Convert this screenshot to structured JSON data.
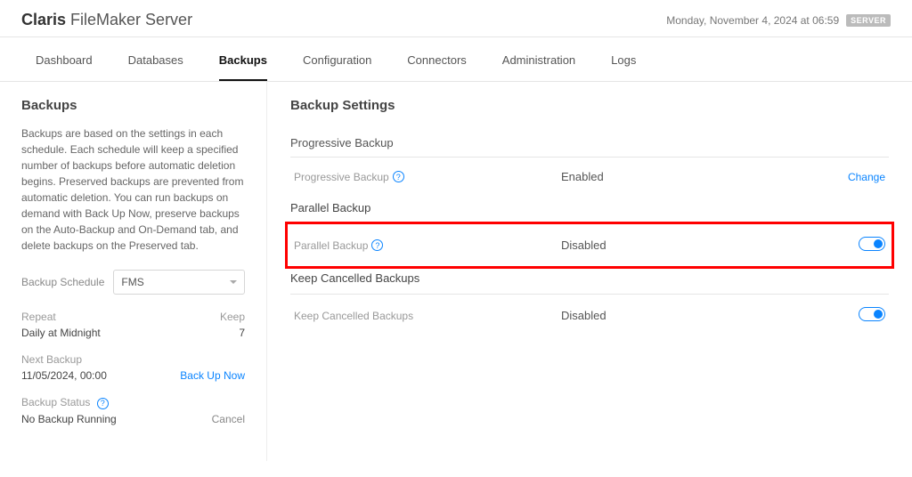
{
  "header": {
    "brand_bold": "Claris",
    "brand_light": " FileMaker Server",
    "datetime": "Monday, November 4, 2024 at 06:59",
    "badge": "SERVER"
  },
  "tabs": [
    {
      "label": "Dashboard",
      "active": false
    },
    {
      "label": "Databases",
      "active": false
    },
    {
      "label": "Backups",
      "active": true
    },
    {
      "label": "Configuration",
      "active": false
    },
    {
      "label": "Connectors",
      "active": false
    },
    {
      "label": "Administration",
      "active": false
    },
    {
      "label": "Logs",
      "active": false
    }
  ],
  "sidebar": {
    "title": "Backups",
    "description": "Backups are based on the settings in each schedule. Each schedule will keep a specified number of backups before automatic deletion begins. Preserved backups are prevented from automatic deletion. You can run backups on demand with Back Up Now, preserve backups on the Auto-Backup and On-Demand tab, and delete backups on the Preserved tab.",
    "schedule_label": "Backup Schedule",
    "schedule_value": "FMS",
    "repeat_label": "Repeat",
    "repeat_value": "Daily at Midnight",
    "keep_label": "Keep",
    "keep_value": "7",
    "next_backup_label": "Next Backup",
    "next_backup_value": "11/05/2024, 00:00",
    "backup_now": "Back Up Now",
    "backup_status_label": "Backup Status",
    "backup_status_value": "No Backup Running",
    "cancel": "Cancel"
  },
  "main": {
    "title": "Backup Settings",
    "sections": {
      "progressive": {
        "heading": "Progressive Backup",
        "row_label": "Progressive Backup",
        "row_value": "Enabled",
        "action": "Change"
      },
      "parallel": {
        "heading": "Parallel Backup",
        "row_label": "Parallel Backup",
        "row_value": "Disabled"
      },
      "keep_cancelled": {
        "heading": "Keep Cancelled Backups",
        "row_label": "Keep Cancelled Backups",
        "row_value": "Disabled"
      }
    }
  },
  "glyphs": {
    "question": "?"
  }
}
